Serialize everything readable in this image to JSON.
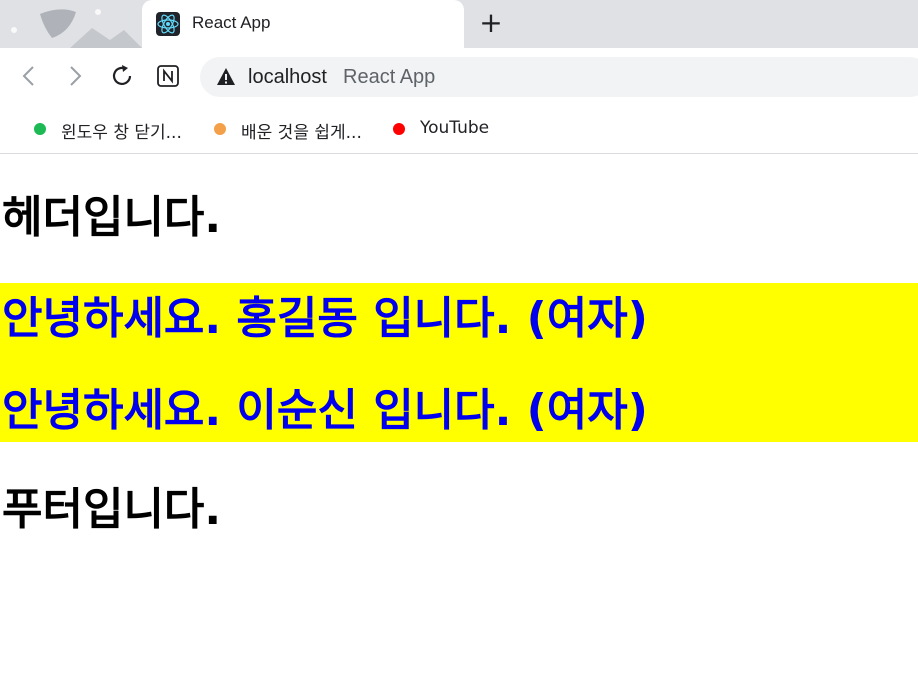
{
  "browser": {
    "tab": {
      "title": "React App",
      "favicon": "react-logo-icon"
    },
    "new_tab_symbol": "+",
    "address": {
      "host": "localhost",
      "page_title": "React App"
    },
    "bookmarks": [
      {
        "label": "윈도우 창 닫기...",
        "color": "#1db954"
      },
      {
        "label": "배운 것을 쉽게...",
        "color": "#f4a04a"
      },
      {
        "label": "YouTube",
        "color": "#ff0000"
      }
    ]
  },
  "page": {
    "header": "헤더입니다.",
    "greetings": [
      "안녕하세요. 홍길동 입니다. (여자)",
      "안녕하세요. 이순신 입니다. (여자)"
    ],
    "greeting_bg": "#ffff00",
    "greeting_color": "#0000ee",
    "footer": "푸터입니다."
  }
}
